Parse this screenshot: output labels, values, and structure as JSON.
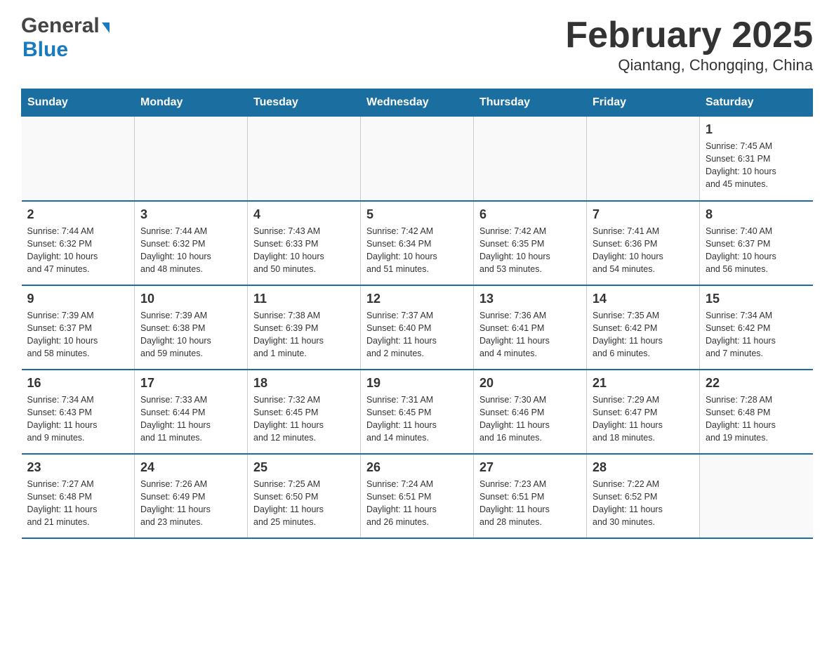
{
  "header": {
    "title": "February 2025",
    "subtitle": "Qiantang, Chongqing, China",
    "logo_general": "General",
    "logo_blue": "Blue"
  },
  "days_of_week": [
    "Sunday",
    "Monday",
    "Tuesday",
    "Wednesday",
    "Thursday",
    "Friday",
    "Saturday"
  ],
  "weeks": [
    {
      "days": [
        {
          "num": "",
          "info": ""
        },
        {
          "num": "",
          "info": ""
        },
        {
          "num": "",
          "info": ""
        },
        {
          "num": "",
          "info": ""
        },
        {
          "num": "",
          "info": ""
        },
        {
          "num": "",
          "info": ""
        },
        {
          "num": "1",
          "info": "Sunrise: 7:45 AM\nSunset: 6:31 PM\nDaylight: 10 hours\nand 45 minutes."
        }
      ]
    },
    {
      "days": [
        {
          "num": "2",
          "info": "Sunrise: 7:44 AM\nSunset: 6:32 PM\nDaylight: 10 hours\nand 47 minutes."
        },
        {
          "num": "3",
          "info": "Sunrise: 7:44 AM\nSunset: 6:32 PM\nDaylight: 10 hours\nand 48 minutes."
        },
        {
          "num": "4",
          "info": "Sunrise: 7:43 AM\nSunset: 6:33 PM\nDaylight: 10 hours\nand 50 minutes."
        },
        {
          "num": "5",
          "info": "Sunrise: 7:42 AM\nSunset: 6:34 PM\nDaylight: 10 hours\nand 51 minutes."
        },
        {
          "num": "6",
          "info": "Sunrise: 7:42 AM\nSunset: 6:35 PM\nDaylight: 10 hours\nand 53 minutes."
        },
        {
          "num": "7",
          "info": "Sunrise: 7:41 AM\nSunset: 6:36 PM\nDaylight: 10 hours\nand 54 minutes."
        },
        {
          "num": "8",
          "info": "Sunrise: 7:40 AM\nSunset: 6:37 PM\nDaylight: 10 hours\nand 56 minutes."
        }
      ]
    },
    {
      "days": [
        {
          "num": "9",
          "info": "Sunrise: 7:39 AM\nSunset: 6:37 PM\nDaylight: 10 hours\nand 58 minutes."
        },
        {
          "num": "10",
          "info": "Sunrise: 7:39 AM\nSunset: 6:38 PM\nDaylight: 10 hours\nand 59 minutes."
        },
        {
          "num": "11",
          "info": "Sunrise: 7:38 AM\nSunset: 6:39 PM\nDaylight: 11 hours\nand 1 minute."
        },
        {
          "num": "12",
          "info": "Sunrise: 7:37 AM\nSunset: 6:40 PM\nDaylight: 11 hours\nand 2 minutes."
        },
        {
          "num": "13",
          "info": "Sunrise: 7:36 AM\nSunset: 6:41 PM\nDaylight: 11 hours\nand 4 minutes."
        },
        {
          "num": "14",
          "info": "Sunrise: 7:35 AM\nSunset: 6:42 PM\nDaylight: 11 hours\nand 6 minutes."
        },
        {
          "num": "15",
          "info": "Sunrise: 7:34 AM\nSunset: 6:42 PM\nDaylight: 11 hours\nand 7 minutes."
        }
      ]
    },
    {
      "days": [
        {
          "num": "16",
          "info": "Sunrise: 7:34 AM\nSunset: 6:43 PM\nDaylight: 11 hours\nand 9 minutes."
        },
        {
          "num": "17",
          "info": "Sunrise: 7:33 AM\nSunset: 6:44 PM\nDaylight: 11 hours\nand 11 minutes."
        },
        {
          "num": "18",
          "info": "Sunrise: 7:32 AM\nSunset: 6:45 PM\nDaylight: 11 hours\nand 12 minutes."
        },
        {
          "num": "19",
          "info": "Sunrise: 7:31 AM\nSunset: 6:45 PM\nDaylight: 11 hours\nand 14 minutes."
        },
        {
          "num": "20",
          "info": "Sunrise: 7:30 AM\nSunset: 6:46 PM\nDaylight: 11 hours\nand 16 minutes."
        },
        {
          "num": "21",
          "info": "Sunrise: 7:29 AM\nSunset: 6:47 PM\nDaylight: 11 hours\nand 18 minutes."
        },
        {
          "num": "22",
          "info": "Sunrise: 7:28 AM\nSunset: 6:48 PM\nDaylight: 11 hours\nand 19 minutes."
        }
      ]
    },
    {
      "days": [
        {
          "num": "23",
          "info": "Sunrise: 7:27 AM\nSunset: 6:48 PM\nDaylight: 11 hours\nand 21 minutes."
        },
        {
          "num": "24",
          "info": "Sunrise: 7:26 AM\nSunset: 6:49 PM\nDaylight: 11 hours\nand 23 minutes."
        },
        {
          "num": "25",
          "info": "Sunrise: 7:25 AM\nSunset: 6:50 PM\nDaylight: 11 hours\nand 25 minutes."
        },
        {
          "num": "26",
          "info": "Sunrise: 7:24 AM\nSunset: 6:51 PM\nDaylight: 11 hours\nand 26 minutes."
        },
        {
          "num": "27",
          "info": "Sunrise: 7:23 AM\nSunset: 6:51 PM\nDaylight: 11 hours\nand 28 minutes."
        },
        {
          "num": "28",
          "info": "Sunrise: 7:22 AM\nSunset: 6:52 PM\nDaylight: 11 hours\nand 30 minutes."
        },
        {
          "num": "",
          "info": ""
        }
      ]
    }
  ]
}
